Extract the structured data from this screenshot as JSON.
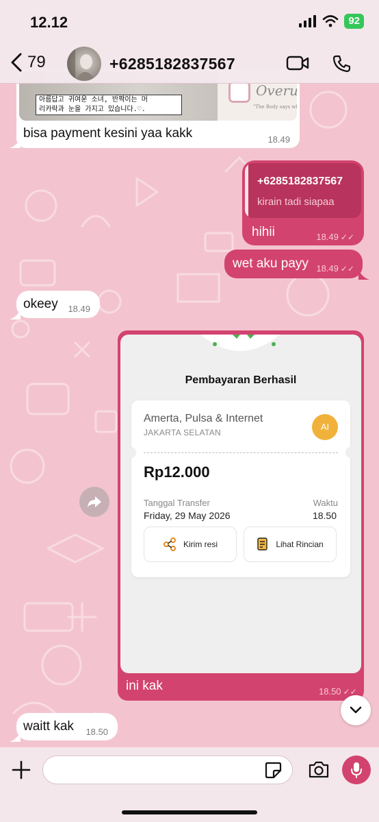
{
  "status_bar": {
    "time": "12.12",
    "battery": "92"
  },
  "header": {
    "back_count": "79",
    "contact_name": "+6285182837567"
  },
  "messages": {
    "m1": {
      "image_caption_line1": "아름답고 귀여운 소녀, 반짝이는 머",
      "image_caption_line2": "리카락과 눈을 가지고 있습니다.♡.",
      "image_side_text": "Overu",
      "image_side_small": "\"The Body says what",
      "text": "bisa payment kesini yaa kakk",
      "time": "18.49"
    },
    "m2": {
      "quote_author": "+6285182837567",
      "quote_text": "kirain tadi siapaa",
      "text": "hihii",
      "time": "18.49"
    },
    "m3": {
      "text": "wet aku payy",
      "time": "18.49"
    },
    "m4": {
      "text": "okeey",
      "time": "18.49"
    },
    "m5": {
      "receipt": {
        "title": "Pembayaran Berhasil",
        "merchant": "Amerta, Pulsa & Internet",
        "location": "JAKARTA SELATAN",
        "badge": "AI",
        "amount": "Rp12.000",
        "date_label": "Tanggal Transfer",
        "date_value": "Friday, 29 May 2026",
        "time_label": "Waktu",
        "time_value": "18.50",
        "send_receipt": "Kirim resi",
        "see_details": "Lihat Rincian"
      },
      "text": "ini kak",
      "time": "18.50"
    },
    "m6": {
      "text": "waitt kak",
      "time": "18.50"
    }
  },
  "colors": {
    "accent": "#d3436f",
    "wallpaper": "#f3c4cf",
    "battery": "#34c759"
  },
  "icons": [
    "back-chevron-icon",
    "video-call-icon",
    "phone-icon",
    "forward-icon",
    "chevron-down-icon",
    "plus-icon",
    "sticker-icon",
    "camera-icon",
    "mic-icon",
    "share-icon",
    "receipt-icon"
  ]
}
